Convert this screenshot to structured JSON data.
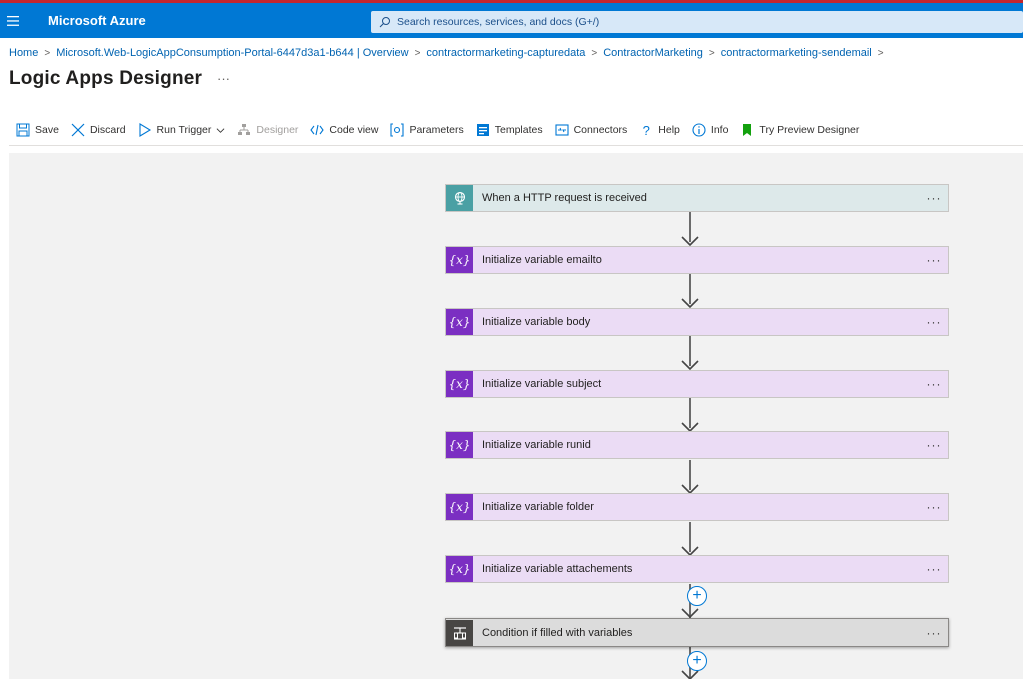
{
  "topbar": {
    "brand": "Microsoft Azure",
    "search_placeholder": "Search resources, services, and docs (G+/)",
    "accent_color": "#0078d4"
  },
  "breadcrumb": [
    "Home",
    "Microsoft.Web-LogicAppConsumption-Portal-6447d3a1-b644 | Overview",
    "contractormarketing-capturedata",
    "ContractorMarketing",
    "contractormarketing-sendemail"
  ],
  "page": {
    "title": "Logic Apps Designer",
    "more": "···"
  },
  "toolbar": {
    "save": "Save",
    "discard": "Discard",
    "run_trigger": "Run Trigger",
    "designer": "Designer",
    "code_view": "Code view",
    "parameters": "Parameters",
    "templates": "Templates",
    "connectors": "Connectors",
    "help": "Help",
    "info": "Info",
    "try_preview": "Try Preview Designer"
  },
  "steps": [
    {
      "label": "When a HTTP request is received",
      "kind": "trigger",
      "icon": "http-request-icon",
      "more": "···"
    },
    {
      "label": "Initialize variable emailto",
      "kind": "variable",
      "icon": "variable-icon",
      "more": "···"
    },
    {
      "label": "Initialize variable body",
      "kind": "variable",
      "icon": "variable-icon",
      "more": "···"
    },
    {
      "label": "Initialize variable subject",
      "kind": "variable",
      "icon": "variable-icon",
      "more": "···"
    },
    {
      "label": "Initialize variable runid",
      "kind": "variable",
      "icon": "variable-icon",
      "more": "···"
    },
    {
      "label": "Initialize variable folder",
      "kind": "variable",
      "icon": "variable-icon",
      "more": "···"
    },
    {
      "label": "Initialize variable attachements",
      "kind": "variable",
      "icon": "variable-icon",
      "more": "···"
    },
    {
      "label": "Condition if filled with variables",
      "kind": "condition",
      "icon": "condition-icon",
      "more": "···"
    }
  ],
  "var_icon_text": "{x}",
  "plus_symbol": "+"
}
